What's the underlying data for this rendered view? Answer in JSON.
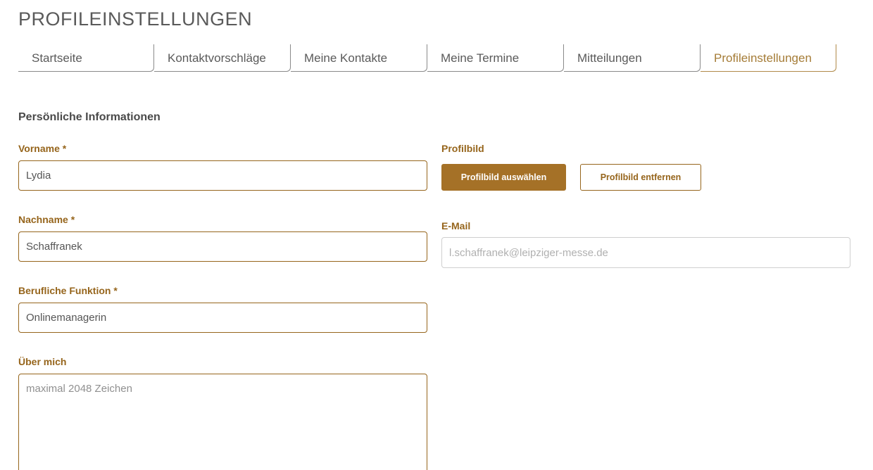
{
  "header": {
    "title": "PROFILEINSTELLUNGEN"
  },
  "tabs": [
    {
      "label": "Startseite",
      "active": false
    },
    {
      "label": "Kontaktvorschläge",
      "active": false
    },
    {
      "label": "Meine Kontakte",
      "active": false
    },
    {
      "label": "Meine Termine",
      "active": false
    },
    {
      "label": "Mitteilungen",
      "active": false
    },
    {
      "label": "Profileinstellungen",
      "active": true
    }
  ],
  "section": {
    "title": "Persönliche Informationen"
  },
  "form": {
    "vorname": {
      "label": "Vorname *",
      "value": "Lydia"
    },
    "nachname": {
      "label": "Nachname *",
      "value": "Schaffranek"
    },
    "funktion": {
      "label": "Berufliche Funktion *",
      "value": "Onlinemanagerin"
    },
    "ueber_mich": {
      "label": "Über mich",
      "value": "",
      "placeholder": "maximal 2048 Zeichen"
    },
    "profilbild": {
      "label": "Profilbild",
      "select_label": "Profilbild auswählen",
      "remove_label": "Profilbild entfernen"
    },
    "email": {
      "label": "E-Mail",
      "value": "l.schaffranek@leipziger-messe.de"
    }
  },
  "colors": {
    "accent": "#96651c",
    "button_primary": "#a57127",
    "active_tab": "#a57c37"
  }
}
